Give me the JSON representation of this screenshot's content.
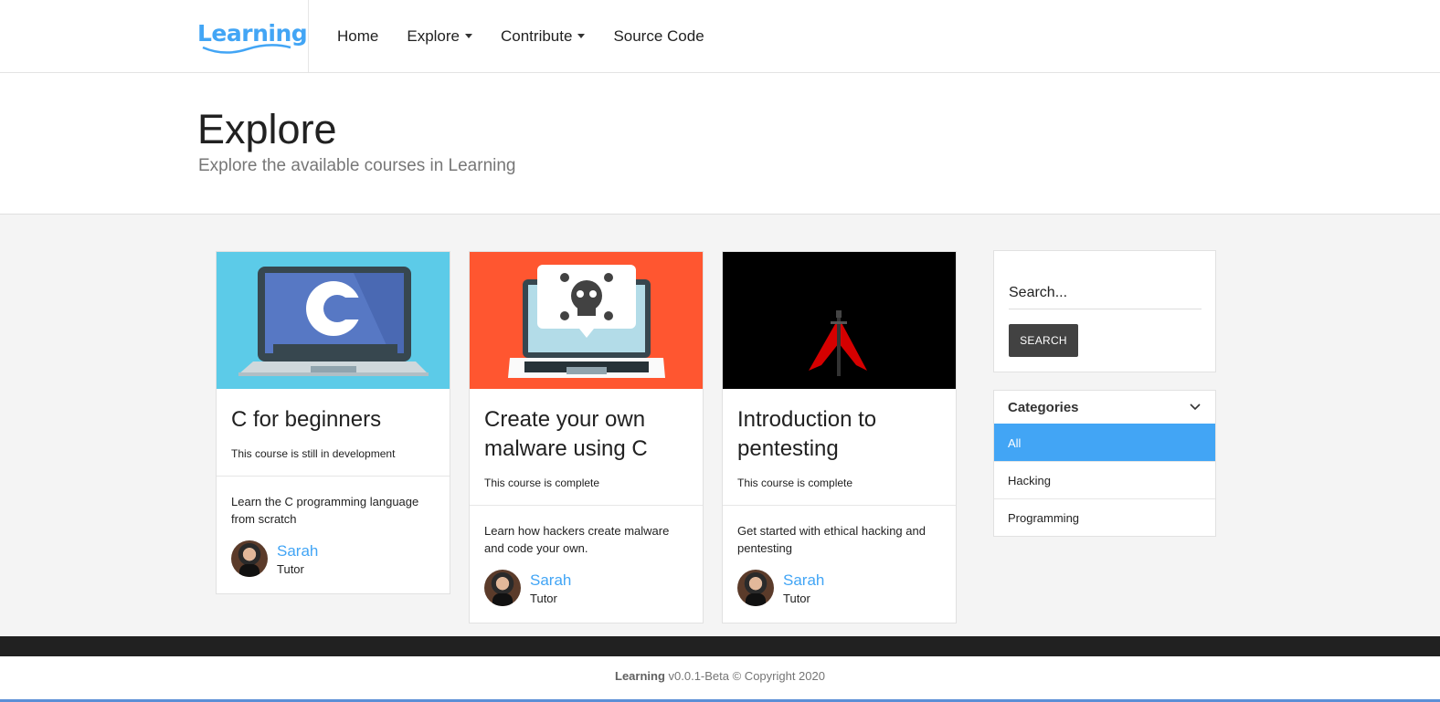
{
  "brand": {
    "name": "Learning"
  },
  "nav": {
    "home": "Home",
    "explore": "Explore",
    "contribute": "Contribute",
    "source": "Source Code"
  },
  "header": {
    "title": "Explore",
    "subtitle": "Explore the available courses in Learning"
  },
  "courses": [
    {
      "title": "C for beginners",
      "status": "This course is still in development",
      "description": "Learn the C programming language from scratch",
      "author": "Sarah",
      "role": "Tutor",
      "image_bg": "#5ccbe8"
    },
    {
      "title": "Create your own malware using C",
      "status": "This course is complete",
      "description": "Learn how hackers create malware and code your own.",
      "author": "Sarah",
      "role": "Tutor",
      "image_bg": "#ff5630"
    },
    {
      "title": "Introduction to pentesting",
      "status": "This course is complete",
      "description": "Get started with ethical hacking and pentesting",
      "author": "Sarah",
      "role": "Tutor",
      "image_bg": "#000000"
    }
  ],
  "search": {
    "placeholder": "Search...",
    "button": "SEARCH"
  },
  "categories": {
    "title": "Categories",
    "items": [
      "All",
      "Hacking",
      "Programming"
    ],
    "selected": "All"
  },
  "footer": {
    "brand": "Learning",
    "text": " v0.0.1-Beta © Copyright 2020"
  },
  "colors": {
    "accent": "#42a5f5",
    "button": "#424242",
    "footer_dark": "#212121"
  },
  "icons": [
    "chevron-down-icon",
    "c-laptop-image",
    "skull-laptop-image",
    "arch-logo-image"
  ]
}
